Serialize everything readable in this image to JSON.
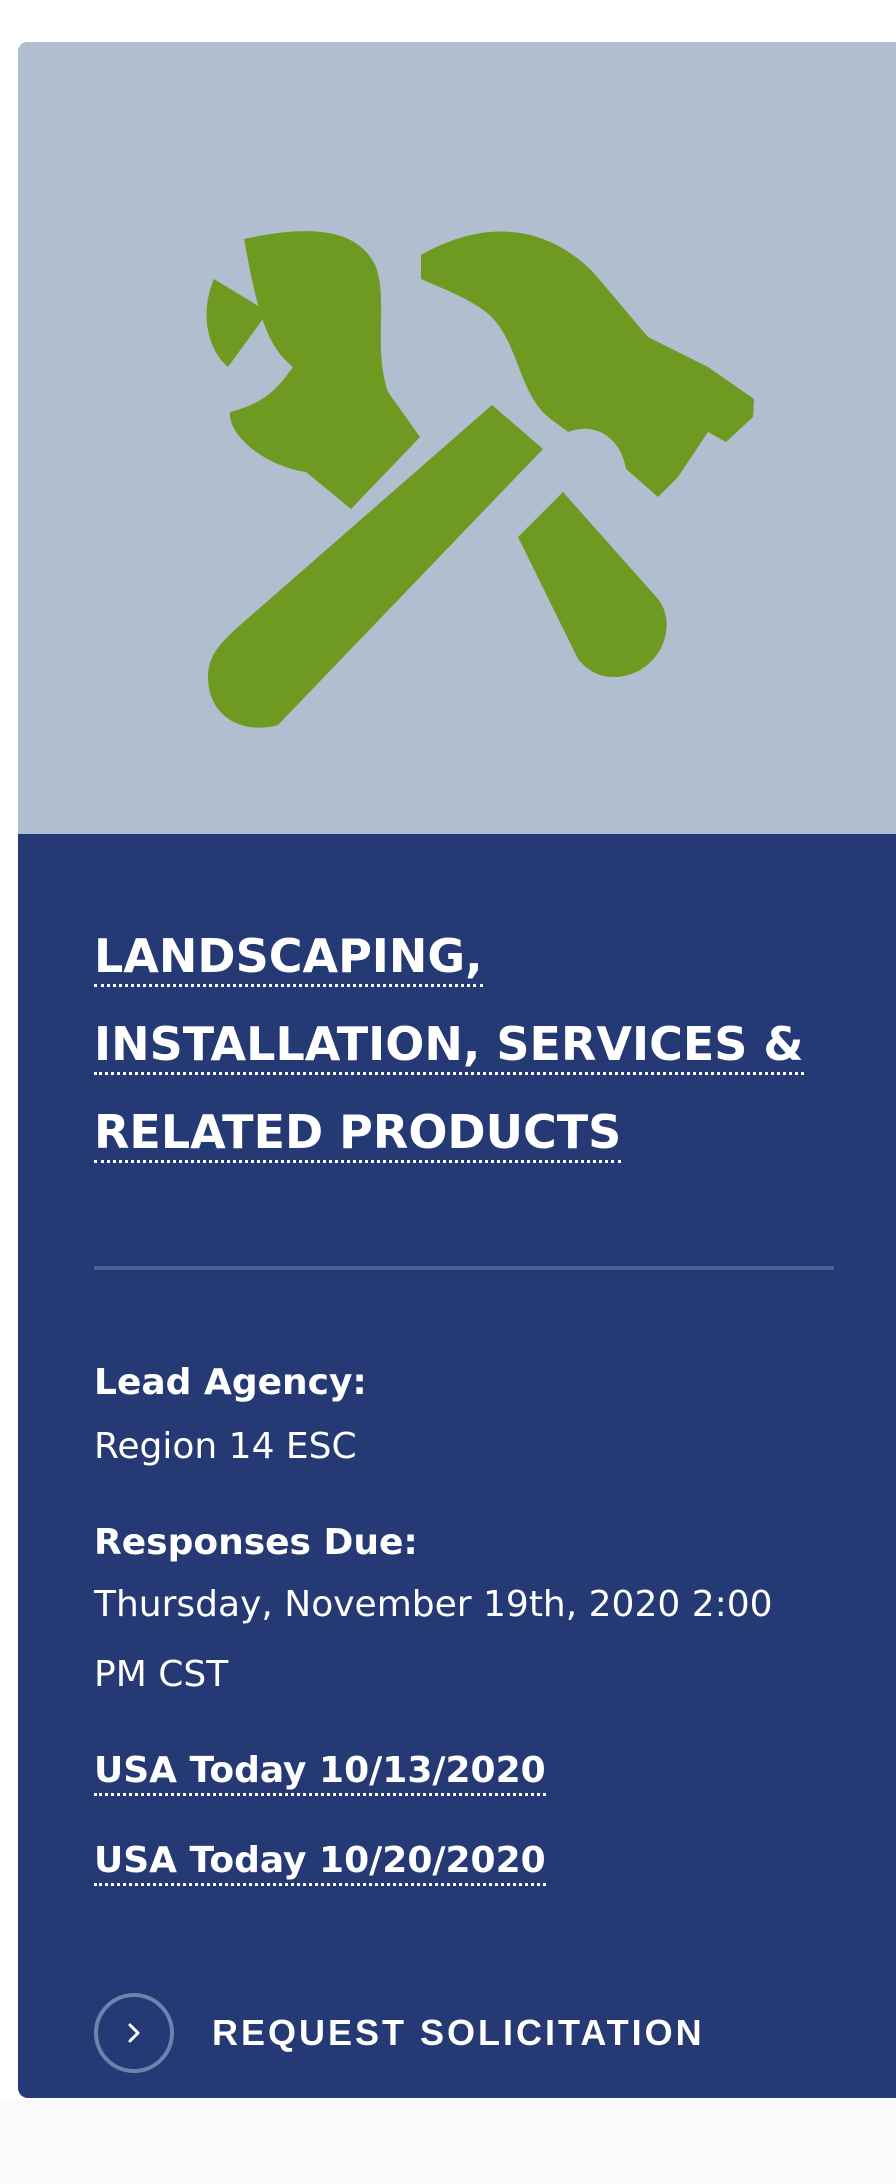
{
  "card": {
    "image": {
      "icon": "hammer-wrench-icon",
      "icon_color": "#6e9a21",
      "background": "#b1becf"
    },
    "panel_color": "#253a74",
    "title_lines": [
      "LANDSCAPING,",
      "INSTALLATION, SERVICES &",
      "RELATED PRODUCTS"
    ],
    "lead_agency": {
      "label": "Lead Agency:",
      "value": "Region 14 ESC"
    },
    "responses_due": {
      "label": "Responses Due:",
      "value": "Thursday, November 19th, 2020 2:00 PM CST"
    },
    "links": [
      "USA Today 10/13/2020",
      "USA Today 10/20/2020"
    ],
    "request_button": {
      "label": "REQUEST SOLICITATION",
      "icon": "chevron-right-icon"
    }
  }
}
